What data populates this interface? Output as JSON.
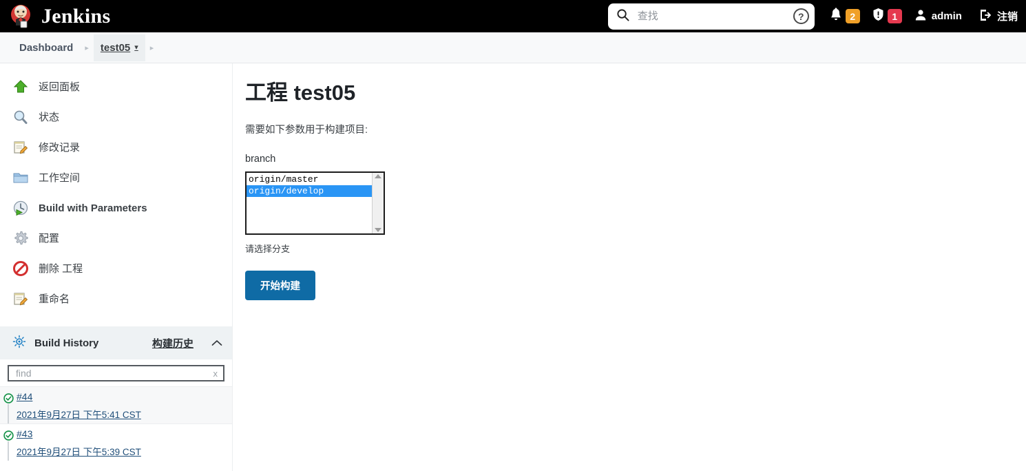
{
  "header": {
    "brand": "Jenkins",
    "logo_icon": "jenkins-butler-icon",
    "search": {
      "placeholder": "查找",
      "value": "",
      "icon": "search-icon",
      "help_icon": "help-circle-icon",
      "help_label": "?"
    },
    "notifications": {
      "icon": "bell-icon",
      "count": "2",
      "color": "#f0a028"
    },
    "security": {
      "icon": "shield-alert-icon",
      "count": "1",
      "color": "#e5394f"
    },
    "user": {
      "icon": "person-icon",
      "label": "admin"
    },
    "logout": {
      "icon": "logout-arrow-icon",
      "label": "注销"
    }
  },
  "breadcrumb": {
    "separator": "▸",
    "items": [
      {
        "label": "Dashboard",
        "active": false,
        "has_chevron": false
      },
      {
        "label": "test05",
        "active": true,
        "has_chevron": true
      }
    ],
    "chevron": "▾"
  },
  "sidebar": {
    "tasks": [
      {
        "label": "返回面板",
        "icon": "up-arrow-green-icon"
      },
      {
        "label": "状态",
        "icon": "magnifier-icon"
      },
      {
        "label": "修改记录",
        "icon": "notepad-pencil-icon"
      },
      {
        "label": "工作空间",
        "icon": "folder-icon"
      },
      {
        "label": "Build with Parameters",
        "icon": "clock-play-icon"
      },
      {
        "label": "配置",
        "icon": "gear-icon"
      },
      {
        "label": "删除 工程",
        "icon": "delete-forbidden-icon"
      },
      {
        "label": "重命名",
        "icon": "notepad-pencil-icon"
      }
    ],
    "build_history": {
      "icon": "weather-sun-icon",
      "title": "Build History",
      "link_label": "构建历史",
      "collapse_icon": "chevron-up-icon",
      "find": {
        "placeholder": "find",
        "value": "",
        "clear_label": "x"
      },
      "builds": [
        {
          "number": "#44",
          "timestamp": "2021年9月27日 下午5:41 CST",
          "status_icon": "success-check-icon"
        },
        {
          "number": "#43",
          "timestamp": "2021年9月27日 下午5:39 CST",
          "status_icon": "success-check-icon"
        }
      ]
    }
  },
  "main": {
    "title": "工程 test05",
    "intro": "需要如下参数用于构建项目:",
    "parameter": {
      "name": "branch",
      "description": "请选择分支",
      "options": [
        {
          "label": "origin/master",
          "selected": false
        },
        {
          "label": "origin/develop",
          "selected": true
        }
      ],
      "selected_color": "#2a95f5"
    },
    "submit_label": "开始构建",
    "submit_color": "#0f6ba5"
  }
}
